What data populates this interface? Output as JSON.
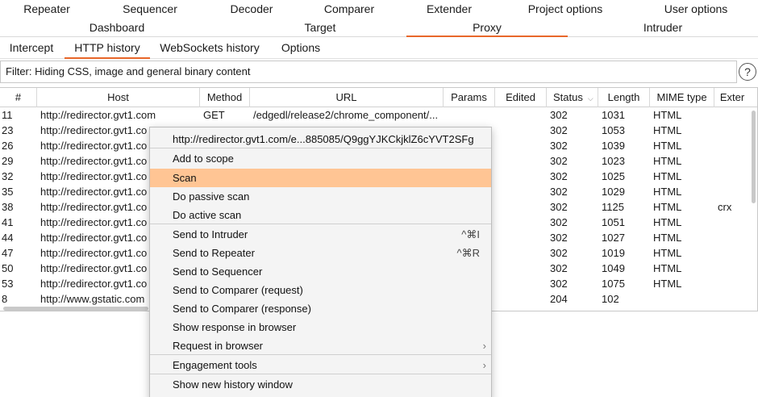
{
  "top_tabs": [
    "Repeater",
    "Sequencer",
    "Decoder",
    "Comparer",
    "Extender",
    "Project options",
    "User options"
  ],
  "second_tabs": [
    "Dashboard",
    "Target",
    "Proxy",
    "Intruder"
  ],
  "active_second_tab": "Proxy",
  "sub_tabs": [
    "Intercept",
    "HTTP history",
    "WebSockets history",
    "Options"
  ],
  "active_sub_tab": "HTTP history",
  "filter": {
    "text": "Filter: Hiding CSS, image and general binary content"
  },
  "help_button": {
    "label": "?"
  },
  "table": {
    "columns": [
      "#",
      "Host",
      "Method",
      "URL",
      "Params",
      "Edited",
      "Status",
      "Length",
      "MIME type",
      "Exter"
    ],
    "sort_indicator": "⌵",
    "rows": [
      {
        "num": "11",
        "host": "http://redirector.gvt1.com",
        "method": "GET",
        "url": "/edgedl/release2/chrome_component/...",
        "status": "302",
        "length": "1031",
        "mime": "HTML",
        "ext": ""
      },
      {
        "num": "23",
        "host": "http://redirector.gvt1.co",
        "method": "",
        "url": "",
        "status": "302",
        "length": "1053",
        "mime": "HTML",
        "ext": ""
      },
      {
        "num": "26",
        "host": "http://redirector.gvt1.co",
        "method": "",
        "url": "",
        "status": "302",
        "length": "1039",
        "mime": "HTML",
        "ext": ""
      },
      {
        "num": "29",
        "host": "http://redirector.gvt1.co",
        "method": "",
        "url": "",
        "status": "302",
        "length": "1023",
        "mime": "HTML",
        "ext": ""
      },
      {
        "num": "32",
        "host": "http://redirector.gvt1.co",
        "method": "",
        "url": "",
        "status": "302",
        "length": "1025",
        "mime": "HTML",
        "ext": ""
      },
      {
        "num": "35",
        "host": "http://redirector.gvt1.co",
        "method": "",
        "url": "",
        "status": "302",
        "length": "1029",
        "mime": "HTML",
        "ext": ""
      },
      {
        "num": "38",
        "host": "http://redirector.gvt1.co",
        "method": "",
        "url": "",
        "status": "302",
        "length": "1125",
        "mime": "HTML",
        "ext": "crx"
      },
      {
        "num": "41",
        "host": "http://redirector.gvt1.co",
        "method": "",
        "url": "",
        "status": "302",
        "length": "1051",
        "mime": "HTML",
        "ext": ""
      },
      {
        "num": "44",
        "host": "http://redirector.gvt1.co",
        "method": "",
        "url": "",
        "status": "302",
        "length": "1027",
        "mime": "HTML",
        "ext": ""
      },
      {
        "num": "47",
        "host": "http://redirector.gvt1.co",
        "method": "",
        "url": "",
        "status": "302",
        "length": "1019",
        "mime": "HTML",
        "ext": ""
      },
      {
        "num": "50",
        "host": "http://redirector.gvt1.co",
        "method": "",
        "url": "",
        "status": "302",
        "length": "1049",
        "mime": "HTML",
        "ext": ""
      },
      {
        "num": "53",
        "host": "http://redirector.gvt1.co",
        "method": "",
        "url": "",
        "status": "302",
        "length": "1075",
        "mime": "HTML",
        "ext": ""
      },
      {
        "num": "8",
        "host": "http://www.gstatic.com",
        "method": "",
        "url": "",
        "status": "204",
        "length": "102",
        "mime": "",
        "ext": ""
      }
    ]
  },
  "context_menu": {
    "items": [
      {
        "label": "http://redirector.gvt1.com/e...885085/Q9ggYJKCkjklZ6cYVT2SFg",
        "shortcut": "",
        "submenu": false
      },
      {
        "label": "Add to scope",
        "shortcut": "",
        "submenu": false
      },
      {
        "label": "Scan",
        "shortcut": "",
        "submenu": false,
        "highlighted": true
      },
      {
        "label": "Do passive scan",
        "shortcut": "",
        "submenu": false
      },
      {
        "label": "Do active scan",
        "shortcut": "",
        "submenu": false
      },
      {
        "label": "Send to Intruder",
        "shortcut": "^⌘I",
        "submenu": false
      },
      {
        "label": "Send to Repeater",
        "shortcut": "^⌘R",
        "submenu": false
      },
      {
        "label": "Send to Sequencer",
        "shortcut": "",
        "submenu": false
      },
      {
        "label": "Send to Comparer (request)",
        "shortcut": "",
        "submenu": false
      },
      {
        "label": "Send to Comparer (response)",
        "shortcut": "",
        "submenu": false
      },
      {
        "label": "Show response in browser",
        "shortcut": "",
        "submenu": false
      },
      {
        "label": "Request in browser",
        "shortcut": "",
        "submenu": true
      },
      {
        "label": "Engagement tools",
        "shortcut": "",
        "submenu": true
      },
      {
        "label": "Show new history window",
        "shortcut": "",
        "submenu": false
      }
    ],
    "submenu_arrow": "›"
  },
  "colors": {
    "accent": "#e8672a",
    "highlight": "#ffc594"
  }
}
